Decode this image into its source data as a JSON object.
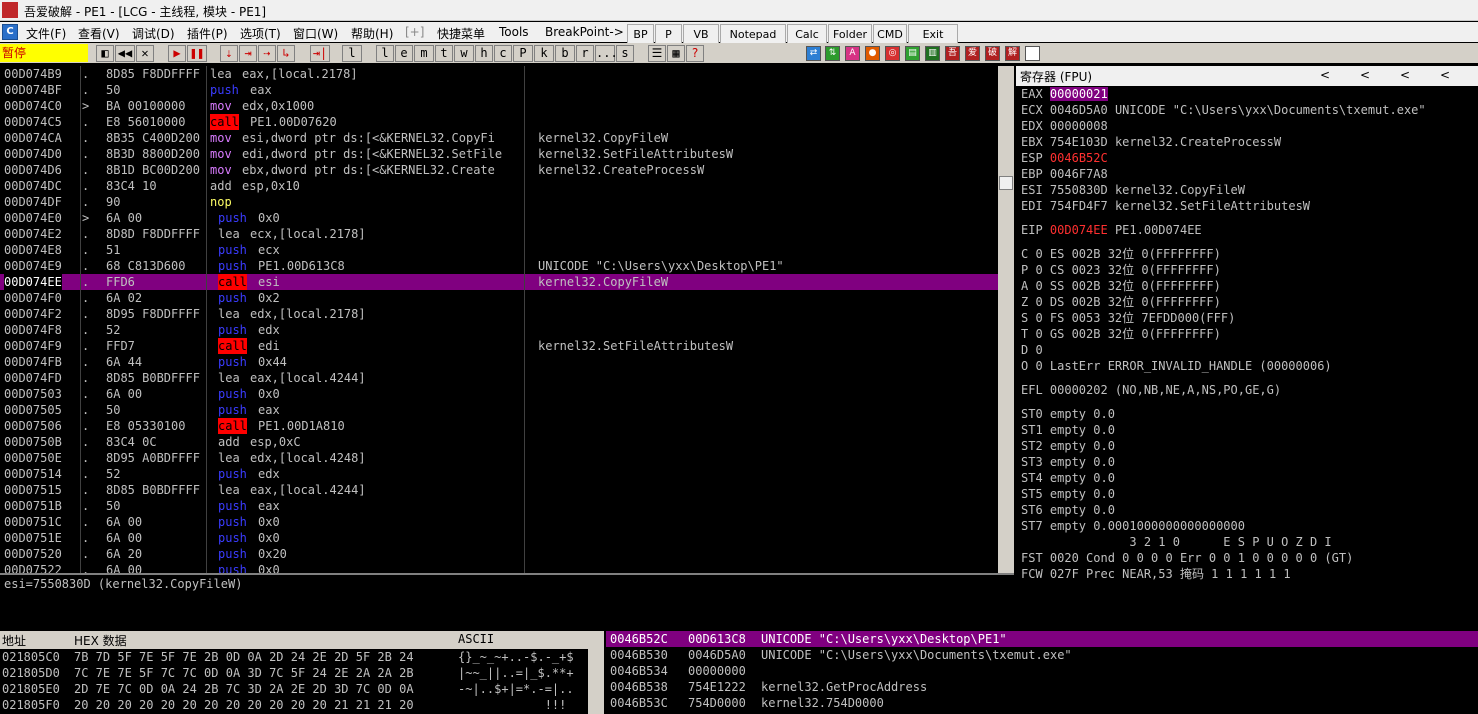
{
  "window": {
    "title": "吾爱破解 - PE1 - [LCG - 主线程, 模块 - PE1]",
    "logo_text": "吾爱破解"
  },
  "menu": {
    "app_icon": "C",
    "items": [
      "文件(F)",
      "查看(V)",
      "调试(D)",
      "插件(P)",
      "选项(T)",
      "窗口(W)",
      "帮助(H)",
      "[+]",
      "快捷菜单",
      "Tools",
      "BreakPoint->"
    ],
    "plugin_buttons": [
      "BP",
      "P",
      "VB",
      "Notepad",
      "Calc",
      "Folder",
      "CMD",
      "Exit"
    ]
  },
  "toolbar": {
    "status": "暂停",
    "buttons": [
      "◧",
      "◀◀",
      "✕",
      "▶",
      "❚❚",
      "⇣",
      "⇥",
      "⇢",
      "↳",
      "⇥|",
      "l",
      "e",
      "m",
      "t",
      "w",
      "h",
      "c",
      "P",
      "k",
      "b",
      "r",
      "...",
      "s",
      "☰",
      "▦",
      "?"
    ],
    "color_buttons": [
      {
        "label": "⇄",
        "color": "#2d7fd3"
      },
      {
        "label": "⇅",
        "color": "#2d9b2d"
      },
      {
        "label": "A",
        "color": "#d63384"
      },
      {
        "label": "●",
        "color": "#e05a00"
      },
      {
        "label": "◎",
        "color": "#d63030"
      },
      {
        "label": "▤",
        "color": "#30a030"
      },
      {
        "label": "▥",
        "color": "#207020"
      },
      {
        "label": "吾",
        "color": "#b02020"
      },
      {
        "label": "爱",
        "color": "#b02020"
      },
      {
        "label": "破",
        "color": "#b02020"
      },
      {
        "label": "解",
        "color": "#b02020"
      },
      {
        "label": "",
        "color": "#ffffff"
      }
    ]
  },
  "disasm": {
    "rows": [
      {
        "addr": "00D074B9",
        "mark": ".",
        "hex": "8D85 F8DDFFFF",
        "op": "lea",
        "args": "eax,[local.2178]",
        "comment": ""
      },
      {
        "addr": "00D074BF",
        "mark": ".",
        "hex": "50",
        "op": "push",
        "args": "eax",
        "comment": ""
      },
      {
        "addr": "00D074C0",
        "mark": ">",
        "hex": "BA 00100000",
        "op": "mov",
        "args": "edx,0x1000",
        "comment": ""
      },
      {
        "addr": "00D074C5",
        "mark": ".",
        "hex": "E8 56010000",
        "op": "call",
        "args": "PE1.00D07620",
        "comment": ""
      },
      {
        "addr": "00D074CA",
        "mark": ".",
        "hex": "8B35 C400D200",
        "op": "mov",
        "args": "esi,dword ptr ds:[<&KERNEL32.CopyFi",
        "comment": "kernel32.CopyFileW"
      },
      {
        "addr": "00D074D0",
        "mark": ".",
        "hex": "8B3D 8800D200",
        "op": "mov",
        "args": "edi,dword ptr ds:[<&KERNEL32.SetFile",
        "comment": "kernel32.SetFileAttributesW"
      },
      {
        "addr": "00D074D6",
        "mark": ".",
        "hex": "8B1D BC00D200",
        "op": "mov",
        "args": "ebx,dword ptr ds:[<&KERNEL32.Create",
        "comment": "kernel32.CreateProcessW"
      },
      {
        "addr": "00D074DC",
        "mark": ".",
        "hex": "83C4 10",
        "op": "add",
        "args": "esp,0x10",
        "comment": ""
      },
      {
        "addr": "00D074DF",
        "mark": ".",
        "hex": "90",
        "op": "nop",
        "args": "",
        "comment": ""
      },
      {
        "addr": "00D074E0",
        "mark": ">",
        "hex": "6A 00",
        "op": "push",
        "args": "0x0",
        "comment": ""
      },
      {
        "addr": "00D074E2",
        "mark": ".",
        "hex": "8D8D F8DDFFFF",
        "op": "lea",
        "args": "ecx,[local.2178]",
        "comment": ""
      },
      {
        "addr": "00D074E8",
        "mark": ".",
        "hex": "51",
        "op": "push",
        "args": "ecx",
        "comment": ""
      },
      {
        "addr": "00D074E9",
        "mark": ".",
        "hex": "68 C813D600",
        "op": "push",
        "args": "PE1.00D613C8",
        "comment": "UNICODE \"C:\\Users\\yxx\\Desktop\\PE1\""
      },
      {
        "addr": "00D074EE",
        "mark": ".",
        "hex": "FFD6",
        "op": "call",
        "args": "esi",
        "comment": "kernel32.CopyFileW"
      },
      {
        "addr": "00D074F0",
        "mark": ".",
        "hex": "6A 02",
        "op": "push",
        "args": "0x2",
        "comment": ""
      },
      {
        "addr": "00D074F2",
        "mark": ".",
        "hex": "8D95 F8DDFFFF",
        "op": "lea",
        "args": "edx,[local.2178]",
        "comment": ""
      },
      {
        "addr": "00D074F8",
        "mark": ".",
        "hex": "52",
        "op": "push",
        "args": "edx",
        "comment": ""
      },
      {
        "addr": "00D074F9",
        "mark": ".",
        "hex": "FFD7",
        "op": "call",
        "args": "edi",
        "comment": "kernel32.SetFileAttributesW"
      },
      {
        "addr": "00D074FB",
        "mark": ".",
        "hex": "6A 44",
        "op": "push",
        "args": "0x44",
        "comment": ""
      },
      {
        "addr": "00D074FD",
        "mark": ".",
        "hex": "8D85 B0BDFFFF",
        "op": "lea",
        "args": "eax,[local.4244]",
        "comment": ""
      },
      {
        "addr": "00D07503",
        "mark": ".",
        "hex": "6A 00",
        "op": "push",
        "args": "0x0",
        "comment": ""
      },
      {
        "addr": "00D07505",
        "mark": ".",
        "hex": "50",
        "op": "push",
        "args": "eax",
        "comment": ""
      },
      {
        "addr": "00D07506",
        "mark": ".",
        "hex": "E8 05330100",
        "op": "call",
        "args": "PE1.00D1A810",
        "comment": ""
      },
      {
        "addr": "00D0750B",
        "mark": ".",
        "hex": "83C4 0C",
        "op": "add",
        "args": "esp,0xC",
        "comment": ""
      },
      {
        "addr": "00D0750E",
        "mark": ".",
        "hex": "8D95 A0BDFFFF",
        "op": "lea",
        "args": "edx,[local.4248]",
        "comment": ""
      },
      {
        "addr": "00D07514",
        "mark": ".",
        "hex": "52",
        "op": "push",
        "args": "edx",
        "comment": ""
      },
      {
        "addr": "00D07515",
        "mark": ".",
        "hex": "8D85 B0BDFFFF",
        "op": "lea",
        "args": "eax,[local.4244]",
        "comment": ""
      },
      {
        "addr": "00D0751B",
        "mark": ".",
        "hex": "50",
        "op": "push",
        "args": "eax",
        "comment": ""
      },
      {
        "addr": "00D0751C",
        "mark": ".",
        "hex": "6A 00",
        "op": "push",
        "args": "0x0",
        "comment": ""
      },
      {
        "addr": "00D0751E",
        "mark": ".",
        "hex": "6A 00",
        "op": "push",
        "args": "0x0",
        "comment": ""
      },
      {
        "addr": "00D07520",
        "mark": ".",
        "hex": "6A 20",
        "op": "push",
        "args": "0x20",
        "comment": ""
      },
      {
        "addr": "00D07522",
        "mark": ".",
        "hex": "6A 00",
        "op": "push",
        "args": "0x0",
        "comment": ""
      }
    ],
    "selected_index": 13
  },
  "info": {
    "text": "esi=7550830D (kernel32.CopyFileW)"
  },
  "registers": {
    "header": "寄存器 (FPU)",
    "nav_arrows": [
      "<",
      "<",
      "<",
      "<"
    ],
    "gprs": [
      {
        "name": "EAX",
        "value": "00000021",
        "note": "",
        "style": "hlbg"
      },
      {
        "name": "ECX",
        "value": "0046D5A0",
        "note": "UNICODE \"C:\\Users\\yxx\\Documents\\txemut.exe\"",
        "style": ""
      },
      {
        "name": "EDX",
        "value": "00000008",
        "note": "",
        "style": ""
      },
      {
        "name": "EBX",
        "value": "754E103D",
        "note": "kernel32.CreateProcessW",
        "style": ""
      },
      {
        "name": "ESP",
        "value": "0046B52C",
        "note": "",
        "style": "hl"
      },
      {
        "name": "EBP",
        "value": "0046F7A8",
        "note": "",
        "style": ""
      },
      {
        "name": "ESI",
        "value": "7550830D",
        "note": "kernel32.CopyFileW",
        "style": ""
      },
      {
        "name": "EDI",
        "value": "754FD4F7",
        "note": "kernel32.SetFileAttributesW",
        "style": ""
      }
    ],
    "eip": {
      "name": "EIP",
      "value": "00D074EE",
      "note": "PE1.00D074EE"
    },
    "flags": [
      "C 0  ES 002B 32位 0(FFFFFFFF)",
      "P 0  CS 0023 32位 0(FFFFFFFF)",
      "A 0  SS 002B 32位 0(FFFFFFFF)",
      "Z 0  DS 002B 32位 0(FFFFFFFF)",
      "S 0  FS 0053 32位 7EFDD000(FFF)",
      "T 0  GS 002B 32位 0(FFFFFFFF)",
      "D 0",
      "O 0  LastErr ERROR_INVALID_HANDLE (00000006)"
    ],
    "efl": "EFL 00000202 (NO,NB,NE,A,NS,PO,GE,G)",
    "fpu": [
      "ST0 empty 0.0",
      "ST1 empty 0.0",
      "ST2 empty 0.0",
      "ST3 empty 0.0",
      "ST4 empty 0.0",
      "ST5 empty 0.0",
      "ST6 empty 0.0",
      "ST7 empty 0.0001000000000000000"
    ],
    "fpu_bits_header": "               3 2 1 0      E S P U O Z D I",
    "fst": "FST 0020  Cond 0 0 0 0  Err 0 0 1 0 0 0 0 0  (GT)",
    "fcw": "FCW 027F  Prec NEAR,53  掩码    1 1 1 1 1 1"
  },
  "dump": {
    "headers": {
      "addr": "地址",
      "hex": "HEX 数据",
      "ascii": "ASCII"
    },
    "rows": [
      {
        "addr": "021805C0",
        "hex": "7B 7D 5F 7E 5F 7E 2B 0D 0A 2D 24 2E 2D 5F 2B 24",
        "ascii": "{}_~_~+..-$.-_+$"
      },
      {
        "addr": "021805D0",
        "hex": "7C 7E 7E 5F 7C 7C 0D 0A 3D 7C 5F 24 2E 2A 2A 2B",
        "ascii": "|~~_||..=|_$.**+"
      },
      {
        "addr": "021805E0",
        "hex": "2D 7E 7C 0D 0A 24 2B 7C 3D 2A 2E 2D 3D 7C 0D 0A",
        "ascii": "-~|..$+|=*.-=|.."
      },
      {
        "addr": "021805F0",
        "hex": "20 20 20 20 20 20 20 20 20 20 20 20 21 21 21 20",
        "ascii": "            !!! "
      }
    ]
  },
  "stack": {
    "rows": [
      {
        "addr": "0046B52C",
        "val": "00D613C8",
        "note": "UNICODE \"C:\\Users\\yxx\\Desktop\\PE1\""
      },
      {
        "addr": "0046B530",
        "val": "0046D5A0",
        "note": "UNICODE \"C:\\Users\\yxx\\Documents\\txemut.exe\""
      },
      {
        "addr": "0046B534",
        "val": "00000000",
        "note": ""
      },
      {
        "addr": "0046B538",
        "val": "754E1222",
        "note": "kernel32.GetProcAddress"
      },
      {
        "addr": "0046B53C",
        "val": "754D0000",
        "note": "kernel32.754D0000"
      }
    ]
  }
}
